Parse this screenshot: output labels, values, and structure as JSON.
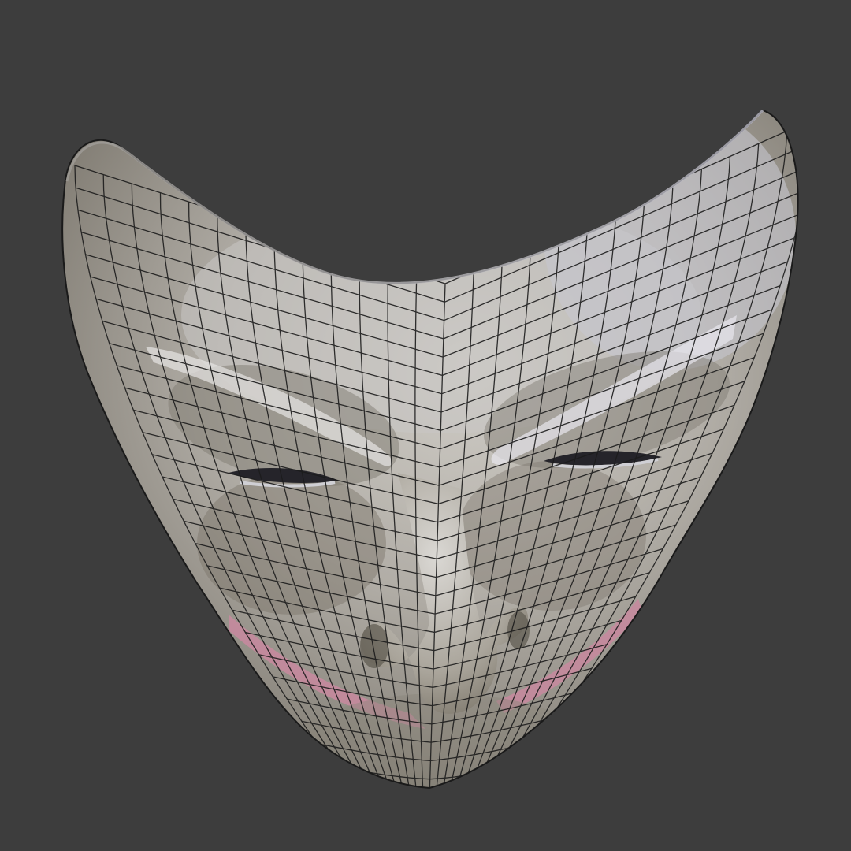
{
  "viewport": {
    "background_color": "#3d3d3d"
  },
  "model": {
    "subject": "theatrical-mask",
    "shading": "solid-with-wireframe",
    "surface_color": "#a8a49c",
    "surface_highlight": "#d7d6d9",
    "surface_shadow": "#6f6a60",
    "wire_color": "#1c1c1c",
    "rim_color": "#aaa9b3",
    "lip_color": "#c58a9d",
    "eye_slit_color": "#25242a"
  }
}
